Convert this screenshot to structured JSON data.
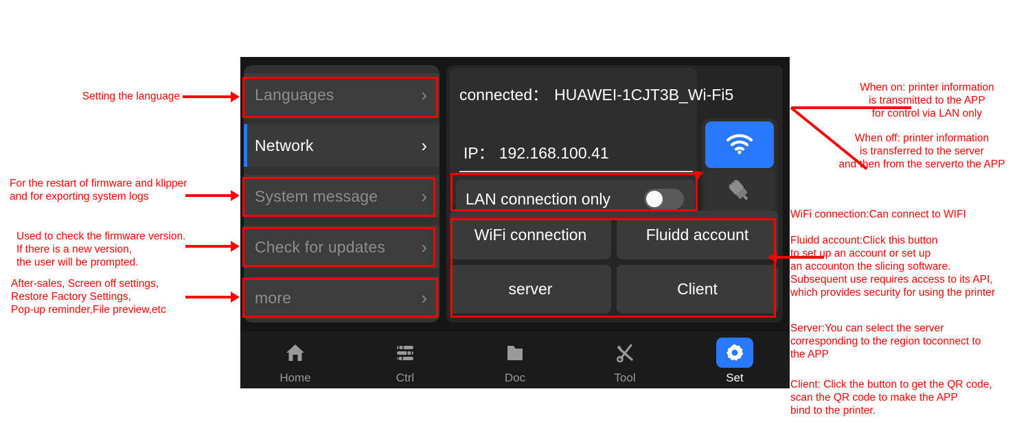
{
  "device": {
    "sidebar": {
      "items": [
        {
          "label": "Languages",
          "active": false,
          "icon": "chevron-right-icon"
        },
        {
          "label": "Network",
          "active": true,
          "icon": "chevron-right-icon"
        },
        {
          "label": "System message",
          "active": false,
          "icon": "chevron-right-icon"
        },
        {
          "label": "Check for updates",
          "active": false,
          "icon": "chevron-right-icon"
        },
        {
          "label": "more",
          "active": false,
          "icon": "chevron-right-icon"
        }
      ]
    },
    "network": {
      "connected_label": "connected：",
      "ssid": "HUAWEI-1CJT3B_Wi-Fi5",
      "ip_label": "IP：",
      "ip_value": "192.168.100.41",
      "lan_toggle_label": "LAN connection only",
      "lan_toggle_state": "off",
      "wifi_button_icon": "wifi-icon",
      "ethernet_button_icon": "ethernet-plug-icon"
    },
    "actions": [
      {
        "label": "WiFi connection"
      },
      {
        "label": "Fluidd account"
      },
      {
        "label": "server"
      },
      {
        "label": "Client"
      }
    ],
    "navbar": {
      "items": [
        {
          "label": "Home",
          "icon": "home-icon",
          "active": false
        },
        {
          "label": "Ctrl",
          "icon": "sliders-icon",
          "active": false
        },
        {
          "label": "Doc",
          "icon": "folder-icon",
          "active": false
        },
        {
          "label": "Tool",
          "icon": "tools-icon",
          "active": false
        },
        {
          "label": "Set",
          "icon": "gear-icon",
          "active": true
        }
      ]
    }
  },
  "annotations": {
    "left": {
      "languages": "Setting the language",
      "system_message": "For the restart of firmware and klipper\nand for exporting system logs",
      "check_updates": "Used to check the firmware version.\nIf there is a new version,\nthe user will be prompted.",
      "more": "After-sales, Screen off settings,\nRestore Factory Settings,\nPop-up reminder,File preview,etc"
    },
    "right": {
      "lan_on": "When on: printer information\nis transmitted to the APP\nfor control via LAN only",
      "lan_off": "When off: printer information\nis transferred to the server\nand then from the serverto the APP",
      "wifi_connection": "WiFi connection:Can connect to WIFI",
      "fluidd_account": "Fluidd account:Click this button\nto set up an account or set up\nan accounton the slicing software.\nSubsequent use requires access to its API,\nwhich provides security for using the printer",
      "server": "Server:You can select the server\ncorresponding to the region toconnect to\nthe APP",
      "client": "Client: Click the button to get the QR code,\nscan the QR code to make the APP\nbind to the printer."
    }
  },
  "colors": {
    "accent": "#2979ff",
    "annotation": "#ff0000",
    "screen_bg": "#161616",
    "panel_bg": "#252525",
    "item_bg": "#3a3a3a"
  }
}
